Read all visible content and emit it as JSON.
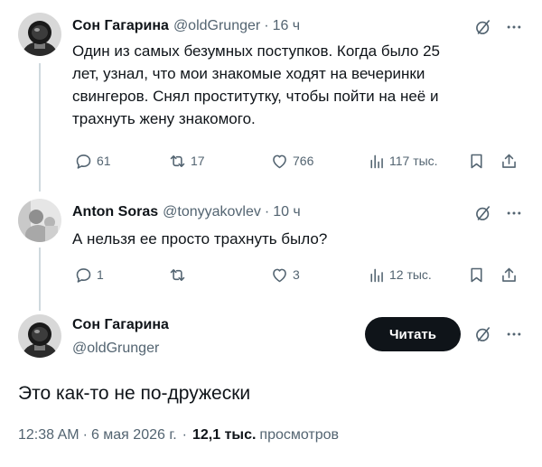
{
  "tweet1": {
    "name": "Сон Гагарина",
    "handle": "@oldGrunger",
    "separator": "·",
    "time": "16 ч",
    "text_lines": [
      "Один из самых безумных поступков. Когда было 25",
      "лет, узнал, что мои знакомые ходят на вечеринки",
      "свингеров. Снял проститутку, чтобы пойти на неё и",
      "трахнуть жену знакомого."
    ],
    "replies": "61",
    "reposts": "17",
    "likes": "766",
    "views": "117 тыс."
  },
  "tweet2": {
    "name": "Anton Soras",
    "handle": "@tonyyakovlev",
    "separator": "·",
    "time": "10 ч",
    "text": "А нельзя ее просто трахнуть было?",
    "replies": "1",
    "reposts": "",
    "likes": "3",
    "views": "12 тыс."
  },
  "main_tweet": {
    "name": "Сон Гагарина",
    "handle": "@oldGrunger",
    "follow_label": "Читать",
    "text": "Это как-то не по-дружески",
    "time": "12:38 AM",
    "separator": "·",
    "date": "6 мая 2026 г.",
    "views_count": "12,1 тыс.",
    "views_label": "просмотров"
  },
  "icons": {
    "more": "more-icon",
    "grok": "grok-slash-icon",
    "reply": "reply-icon",
    "repost": "repost-icon",
    "like": "heart-icon",
    "views": "views-icon",
    "bookmark": "bookmark-icon",
    "share": "share-icon"
  },
  "colors": {
    "text": "#0f1419",
    "secondary": "#536471",
    "thread_line": "#cfd9de",
    "button": "#0f1419"
  }
}
